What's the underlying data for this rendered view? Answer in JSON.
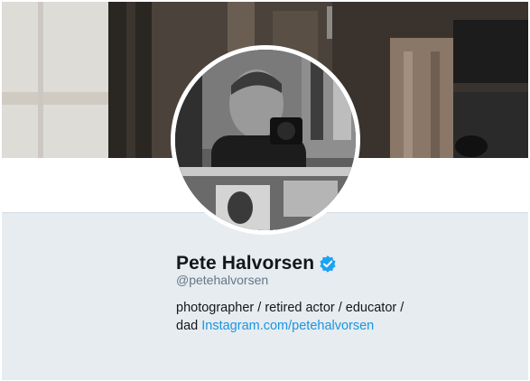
{
  "profile": {
    "name": "Pete Halvorsen",
    "handle": "@petehalvorsen",
    "bio_text": "photographer / retired actor / educator / dad",
    "bio_link": "Instagram.com/petehalvorsen",
    "verified": true
  },
  "colors": {
    "link": "#1b95e0",
    "verified_badge": "#1da1f2",
    "profile_bg": "#e6ecf0",
    "handle_gray": "#657786"
  },
  "icons": {
    "verified": "verified-check-icon"
  }
}
